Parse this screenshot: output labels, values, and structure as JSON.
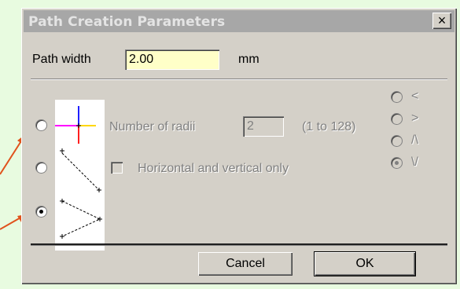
{
  "dialog": {
    "title": "Path Creation Parameters",
    "close_label": "×",
    "path_width_label": "Path width",
    "path_width_value": "2.00",
    "path_width_unit": "mm",
    "radii_label": "Number of radii",
    "radii_value": "2",
    "radii_range": "(1 to 128)",
    "hv_only_label": "Horizontal and vertical only",
    "shape_options": [
      {
        "label": "<",
        "selected": false
      },
      {
        "label": ">",
        "selected": false
      },
      {
        "label": "/\\",
        "selected": false
      },
      {
        "label": "\\/",
        "selected": true
      }
    ],
    "path_style_selected_index": 2,
    "cancel_label": "Cancel",
    "ok_label": "OK"
  },
  "colors": {
    "background": "#e8fbe0",
    "dialog_face": "#d4d0c8",
    "titlebar_inactive": "#a7a7a7",
    "field_highlight": "#ffffc8",
    "annotation_arrow": "#e0521c"
  }
}
